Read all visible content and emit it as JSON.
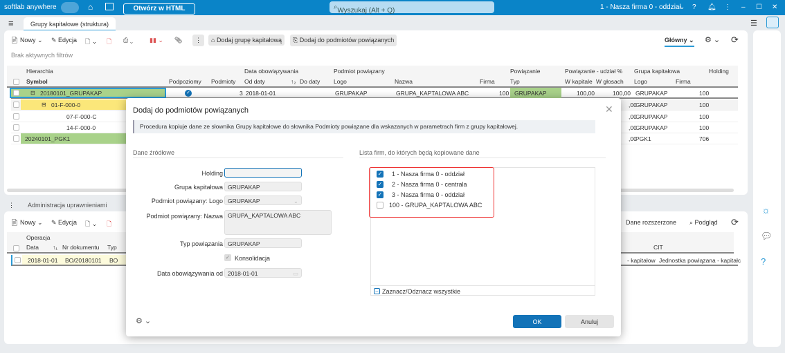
{
  "app": {
    "brand": "softlab anywhere",
    "open_html": "Otwórz w HTML",
    "search_placeholder": "Wyszukaj (Alt + Q)",
    "company": "1 - Nasza firma 0 - oddział",
    "topbar_color": "#0a84c8"
  },
  "tab": {
    "label": "Grupy kapitałowe (struktura)"
  },
  "toolbar": {
    "new": "Nowy",
    "edit": "Edycja",
    "add_group": "Dodaj grupę kapitałową",
    "add_related": "Dodaj do podmiotów powiązanych",
    "view": "Główny"
  },
  "filters": "Brak aktywnych filtrów",
  "grid": {
    "group_headers": [
      "Hierarchia",
      "Data obowiązywania",
      "Podmiot powiązany",
      "Powiązanie",
      "Powiązanie - udział %",
      "Grupa kapitałowa",
      "Holding"
    ],
    "columns": [
      "Symbol",
      "Podpoziomy",
      "Podmioty",
      "Od daty",
      "Do daty",
      "Logo",
      "Nazwa",
      "Firma",
      "Typ",
      "W kapitale",
      "W głosach",
      "Logo",
      "Firma"
    ],
    "rows": [
      {
        "symbol": "20180101_GRUPAKAP",
        "podmioty": "3",
        "od": "2018-01-01",
        "logo": "GRUPAKAP",
        "nazwa": "GRUPA_KAPTALOWA ABC",
        "firma": "100",
        "typ": "GRUPAKAP",
        "wk": "100,00",
        "wg": "100,00",
        "glogo": "GRUPAKAP",
        "gfirma": "100"
      },
      {
        "symbol": "01-F-000-0",
        "glogo": "GRUPAKAP",
        "gfirma": "100",
        "wg": ",00"
      },
      {
        "symbol": "07-F-000-C",
        "glogo": "GRUPAKAP",
        "gfirma": "100",
        "wg": ",00"
      },
      {
        "symbol": "14-F-000-0",
        "glogo": "GRUPAKAP",
        "gfirma": "100",
        "wg": ",00"
      },
      {
        "symbol": "20240101_PGK1",
        "glogo": "PGK1",
        "gfirma": "706",
        "wg": ",00"
      }
    ]
  },
  "bottom": {
    "tab": "Administracja uprawnieniami",
    "new": "Nowy",
    "edit": "Edycja",
    "ext": "Dane rozszerzone",
    "preview": "Podgląd",
    "group_header": "Operacja",
    "columns": [
      "Data",
      "Nr dokumentu",
      "Typ",
      "CIT"
    ],
    "row": {
      "data": "2018-01-01",
      "nr": "BO/20180101",
      "typ": "BO",
      "c1": "- kapitałow",
      "cit": "Jednostka powiązana - kapitałc"
    }
  },
  "dialog": {
    "title": "Dodaj do podmiotów powiązanych",
    "info": "Procedura kopiuje dane ze słownika Grupy kapitałowe do słownika Podmioty powiązane dla wskazanych w parametrach firm z grupy kapitałowej.",
    "left_title": "Dane źródłowe",
    "right_title": "Lista firm, do których będą kopiowane dane",
    "fields": {
      "holding_label": "Holding",
      "holding": "",
      "group_label": "Grupa kapitałowa",
      "group": "GRUPAKAP",
      "logo_label": "Podmiot powiązany: Logo",
      "logo": "GRUPAKAP",
      "name_label": "Podmiot powiązany: Nazwa",
      "name": "GRUPA_KAPTALOWA ABC",
      "type_label": "Typ powiązania",
      "type": "GRUPAKAP",
      "consol_label": "Konsolidacja",
      "consol": true,
      "date_label": "Data obowiązywania od",
      "date": "2018-01-01"
    },
    "firms": [
      {
        "label": "1 - Nasza firma 0 - oddział",
        "checked": true
      },
      {
        "label": "2 - Nasza firma 0 - centrala",
        "checked": true
      },
      {
        "label": "3 - Nasza firma 0 - oddział",
        "checked": true
      },
      {
        "label": "100 - GRUPA_KAPTALOWA ABC",
        "checked": false
      }
    ],
    "toggle_all": "Zaznacz/Odznacz wszystkie",
    "ok": "OK",
    "cancel": "Anuluj"
  }
}
